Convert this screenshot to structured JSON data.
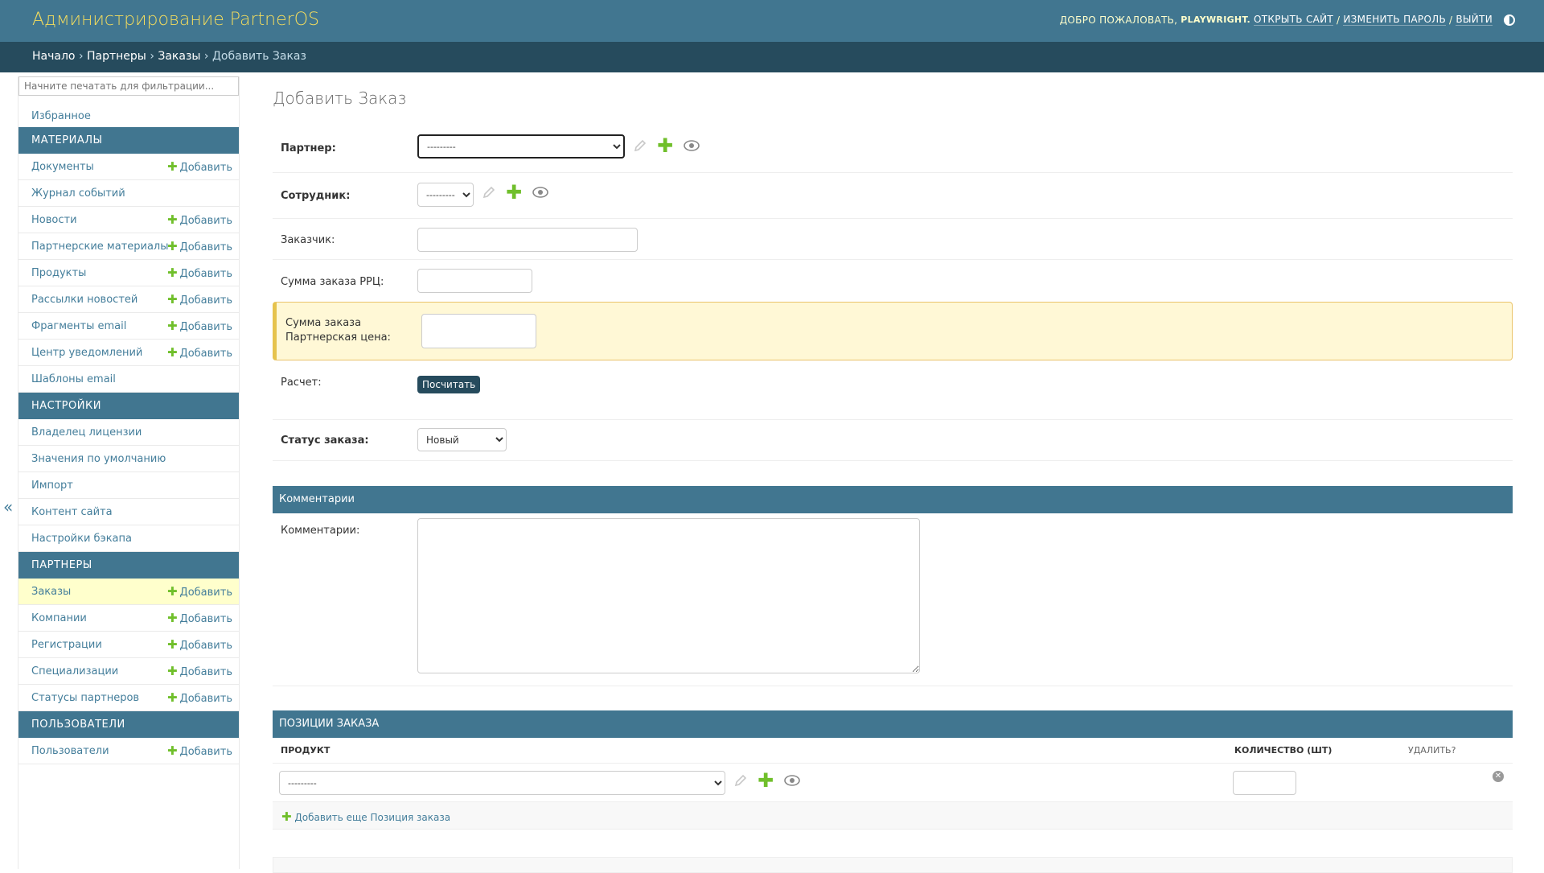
{
  "header": {
    "site_name": "Администрирование PartnerOS",
    "welcome": "Добро пожаловать,",
    "username": "playwright.",
    "view_site": "Открыть сайт",
    "change_password": "Изменить пароль",
    "logout": "Выйти",
    "sep": "/"
  },
  "breadcrumbs": {
    "home": "Начало",
    "partners": "Партнеры",
    "orders": "Заказы",
    "current": "Добавить Заказ",
    "sep": "›"
  },
  "sidebar": {
    "filter_placeholder": "Начните печатать для фильтрации...",
    "favorites": "Избранное",
    "add_label": "Добавить",
    "groups": [
      {
        "caption": "Материалы",
        "items": [
          {
            "label": "Документы",
            "add": true
          },
          {
            "label": "Журнал событий",
            "add": false
          },
          {
            "label": "Новости",
            "add": true
          },
          {
            "label": "Партнерские материалы",
            "add": true
          },
          {
            "label": "Продукты",
            "add": true
          },
          {
            "label": "Рассылки новостей",
            "add": true
          },
          {
            "label": "Фрагменты email",
            "add": true
          },
          {
            "label": "Центр уведомлений",
            "add": true
          },
          {
            "label": "Шаблоны email",
            "add": false
          }
        ]
      },
      {
        "caption": "Настройки",
        "items": [
          {
            "label": "Владелец лицензии",
            "add": false
          },
          {
            "label": "Значения по умолчанию",
            "add": false
          },
          {
            "label": "Импорт",
            "add": false
          },
          {
            "label": "Контент сайта",
            "add": false
          },
          {
            "label": "Настройки бэкапа",
            "add": false
          }
        ]
      },
      {
        "caption": "Партнеры",
        "items": [
          {
            "label": "Заказы",
            "add": true,
            "current": true
          },
          {
            "label": "Компании",
            "add": true
          },
          {
            "label": "Регистрации",
            "add": true
          },
          {
            "label": "Специализации",
            "add": true
          },
          {
            "label": "Статусы партнеров",
            "add": true
          }
        ]
      },
      {
        "caption": "Пользователи",
        "items": [
          {
            "label": "Пользователи",
            "add": true
          }
        ]
      }
    ],
    "collapse": "«"
  },
  "form": {
    "title": "Добавить Заказ",
    "partner_label": "Партнер:",
    "partner_value": "---------",
    "employee_label": "Сотрудник:",
    "employee_value": "---------",
    "customer_label": "Заказчик:",
    "rrp_label": "Сумма заказа РРЦ:",
    "partner_price_label_1": "Сумма заказа",
    "partner_price_label_2": "Партнерская цена:",
    "calc_label": "Расчет:",
    "calc_button": "Посчитать",
    "status_label": "Статус заказа:",
    "status_value": "Новый"
  },
  "comments": {
    "caption": "Комментарии",
    "label": "Комментарии:"
  },
  "positions": {
    "caption": "Позиции заказа",
    "col_product": "Продукт",
    "col_qty": "Количество (шт)",
    "col_delete": "Удалить?",
    "product_value": "---------",
    "add_another": "Добавить еще Позиция заказа"
  },
  "colors": {
    "header_bg": "#417690",
    "breadcrumbs_bg": "#264b5d",
    "brand_yellow": "#f5dd5d",
    "add_green": "#70bf2b",
    "current_row": "#ffffcc",
    "warning_bg": "#fff8d6"
  },
  "icons": [
    "pencil-icon",
    "plus-icon",
    "eye-icon",
    "delete-icon",
    "theme-toggle-icon"
  ]
}
